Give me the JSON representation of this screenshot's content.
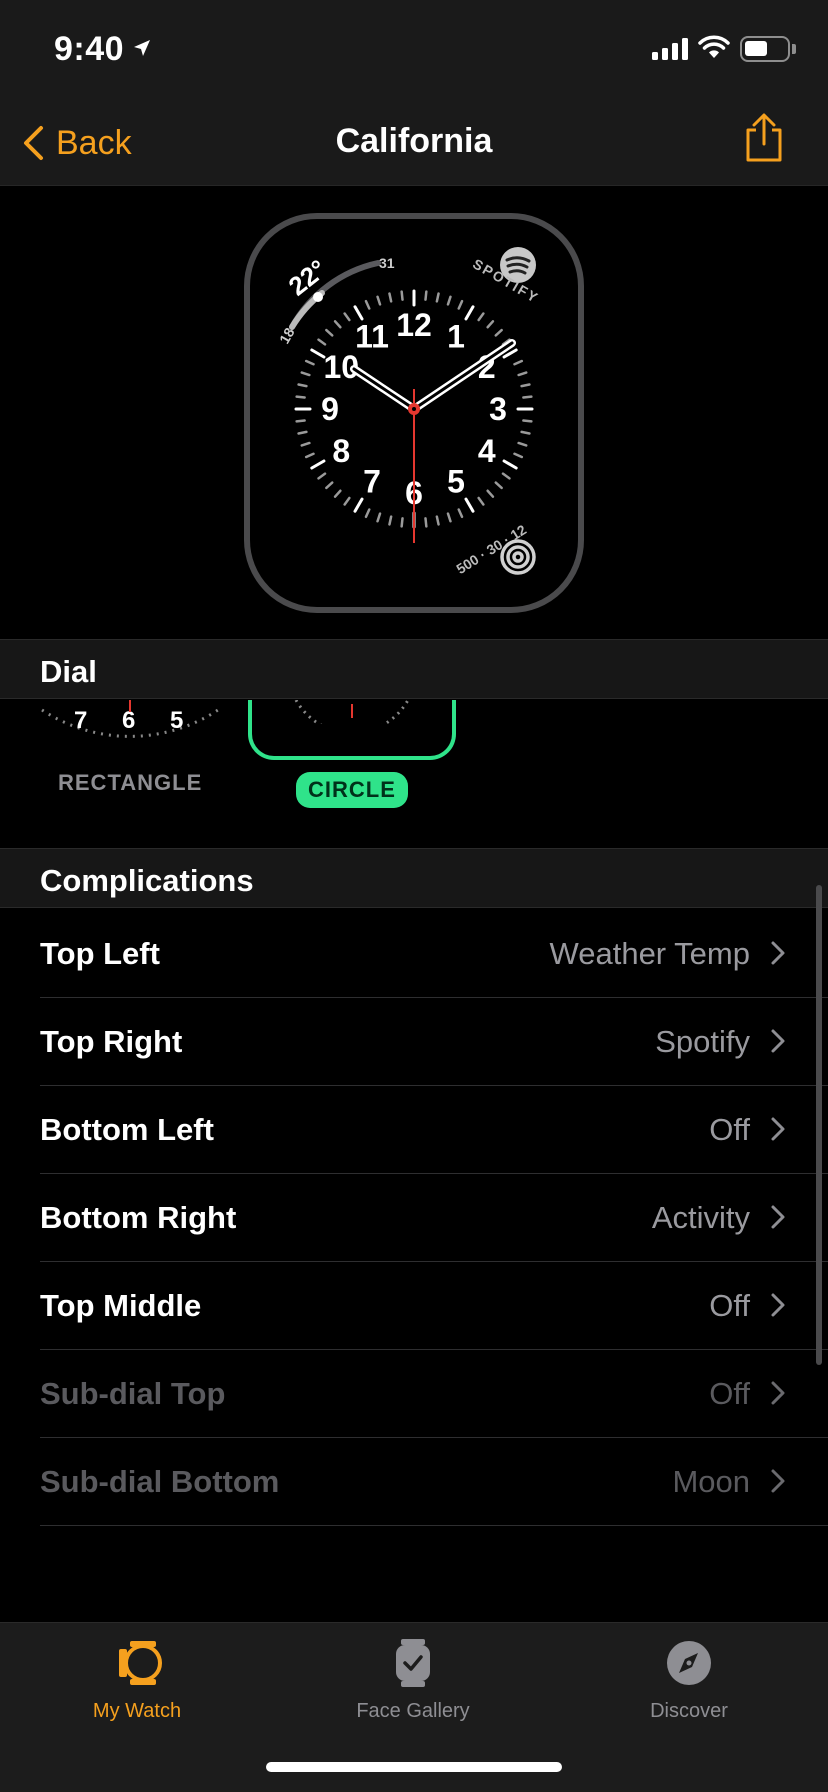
{
  "status_bar": {
    "time": "9:40",
    "battery_level": 0.55
  },
  "nav": {
    "back_label": "Back",
    "title": "California",
    "share_icon": "share-icon"
  },
  "watch_face": {
    "top_left_temp": "22°",
    "top_left_min": "18",
    "top_left_max": "31",
    "top_right_label": "SPOTIFY",
    "bottom_right_label": "500 · 30 · 12",
    "numerals": [
      "12",
      "1",
      "2",
      "3",
      "4",
      "5",
      "6",
      "7",
      "8",
      "9",
      "10",
      "11"
    ],
    "accent_color": "#e5372f"
  },
  "dial": {
    "section_title": "Dial",
    "options": [
      {
        "label": "RECTANGLE",
        "selected": false,
        "numerals": [
          "7",
          "6",
          "5"
        ]
      },
      {
        "label": "CIRCLE",
        "selected": true
      }
    ],
    "selected_color": "#2fe38a"
  },
  "complications": {
    "section_title": "Complications",
    "items": [
      {
        "label": "Top Left",
        "value": "Weather Temp",
        "enabled": true
      },
      {
        "label": "Top Right",
        "value": "Spotify",
        "enabled": true
      },
      {
        "label": "Bottom Left",
        "value": "Off",
        "enabled": true
      },
      {
        "label": "Bottom Right",
        "value": "Activity",
        "enabled": true
      },
      {
        "label": "Top Middle",
        "value": "Off",
        "enabled": true
      },
      {
        "label": "Sub-dial Top",
        "value": "Off",
        "enabled": false
      },
      {
        "label": "Sub-dial Bottom",
        "value": "Moon",
        "enabled": false
      }
    ]
  },
  "tab_bar": {
    "tabs": [
      {
        "label": "My Watch",
        "icon": "watch-icon",
        "active": true
      },
      {
        "label": "Face Gallery",
        "icon": "face-gallery-icon",
        "active": false
      },
      {
        "label": "Discover",
        "icon": "compass-icon",
        "active": false
      }
    ],
    "accent_color": "#f5a01e"
  }
}
